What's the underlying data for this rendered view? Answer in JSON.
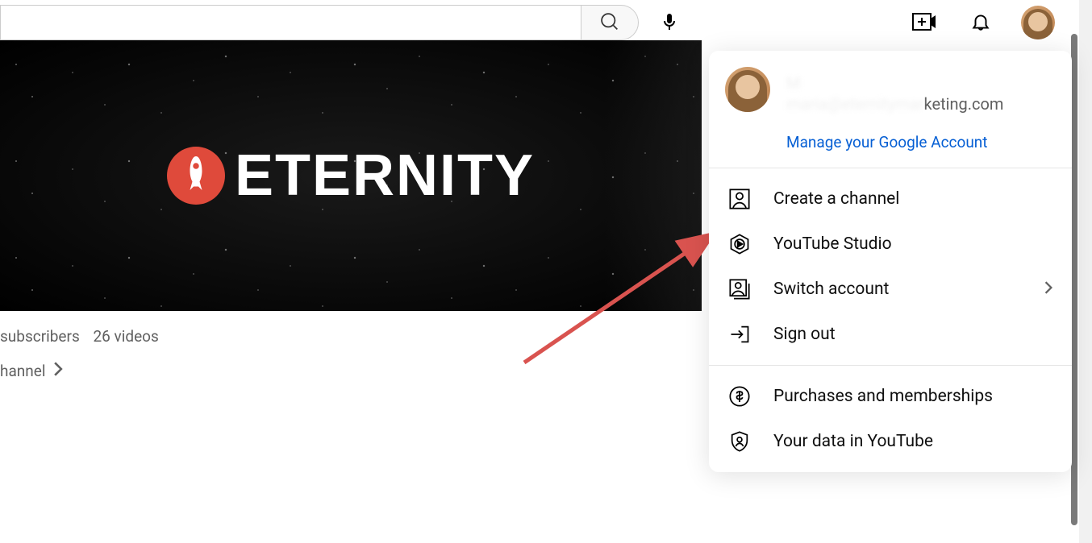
{
  "search": {
    "value": "",
    "placeholder": ""
  },
  "banner": {
    "brand_text": "ETERNITY"
  },
  "channel": {
    "stats_prefix": "",
    "subscribers_label": "subscribers",
    "videos_count": "26 videos",
    "link_text": "hannel"
  },
  "account": {
    "name_obscured": "M",
    "email_visible_suffix": "keting.com",
    "email_obscured_prefix": "maria@eternitymar",
    "manage_label": "Manage your Google Account"
  },
  "menu": {
    "section1": [
      {
        "icon": "user-icon",
        "label": "Create a channel",
        "chevron": false
      },
      {
        "icon": "studio-icon",
        "label": "YouTube Studio",
        "chevron": false
      },
      {
        "icon": "switch-icon",
        "label": "Switch account",
        "chevron": true
      },
      {
        "icon": "signout-icon",
        "label": "Sign out",
        "chevron": false
      }
    ],
    "section2": [
      {
        "icon": "dollar-icon",
        "label": "Purchases and memberships",
        "chevron": false
      },
      {
        "icon": "shield-icon",
        "label": "Your data in YouTube",
        "chevron": false
      }
    ]
  }
}
